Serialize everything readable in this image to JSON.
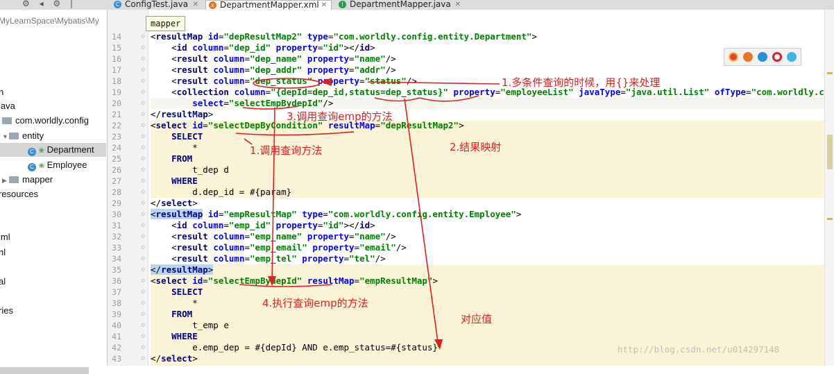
{
  "toolbar": {
    "icons_text": "⚙ ◂ ⚙ |"
  },
  "tabs": [
    {
      "label": "ConfigTest.java",
      "icon": "C",
      "icon_color": "#3a8ecf"
    },
    {
      "label": "DepartmentMapper.xml",
      "icon": "x",
      "icon_color": "#d9762b"
    },
    {
      "label": "DepartmentMapper.java",
      "icon": "I",
      "icon_color": "#2d9a55"
    }
  ],
  "sidebar": {
    "items": [
      {
        "label": "MyLearnSpace\\Mybatis\\My"
      },
      {
        "label": "n"
      },
      {
        "label": "java"
      },
      {
        "label": "com.worldly.config"
      },
      {
        "label": "entity"
      },
      {
        "label": "Department"
      },
      {
        "label": "Employee"
      },
      {
        "label": "mapper"
      },
      {
        "label": "resources"
      },
      {
        "label": "iml"
      },
      {
        "label": "nl"
      },
      {
        "label": "al"
      },
      {
        "label": "ries"
      }
    ]
  },
  "editor": {
    "breadcrumb": "mapper",
    "lines": [
      {
        "num": "14",
        "html": "<span class=\"p\">&lt;</span><span class=\"t\">resultMap</span> <span class=\"a\">id</span>=<span class=\"s\">\"depResultMap2\"</span> <span class=\"a\">type</span>=<span class=\"s\">\"com.worldly.config.entity.Department\"</span>&gt;"
      },
      {
        "num": "15",
        "html": "    &lt;<span class=\"t\">id</span> <span class=\"a\">column</span>=<span class=\"s\">\"dep_id\"</span> <span class=\"a\">property</span>=<span class=\"s\">\"id\"</span>&gt;&lt;/<span class=\"t\">id</span>&gt;"
      },
      {
        "num": "16",
        "html": "    &lt;<span class=\"t\">result</span> <span class=\"a\">column</span>=<span class=\"s\">\"dep_name\"</span> <span class=\"a\">property</span>=<span class=\"s\">\"name\"</span>/&gt;"
      },
      {
        "num": "17",
        "html": "    &lt;<span class=\"t\">result</span> <span class=\"a\">column</span>=<span class=\"s\">\"dep_addr\"</span> <span class=\"a\">property</span>=<span class=\"s\">\"addr\"</span>/&gt;"
      },
      {
        "num": "18",
        "html": "    &lt;<span class=\"t\">result</span> <span class=\"a\">column</span>=<span class=\"s\">\"dep_status\"</span> <span class=\"a\">property</span>=<span class=\"s\">\"status\"</span>/&gt;"
      },
      {
        "num": "19",
        "html": "    &lt;<span class=\"t\">collection</span> <span class=\"a\">column</span>=<span class=\"s\">\"{depId=dep_id,status=dep_status}\"</span> <span class=\"a\">property</span>=<span class=\"s\">\"employeeList\"</span> <span class=\"a\">javaType</span>=<span class=\"s\">\"java.util.List\"</span> <span class=\"a\">ofType</span>=<span class=\"s\">\"com.worldly.config.entity.Employee\"</span>"
      },
      {
        "num": "20",
        "html": "        <span class=\"a\">select</span>=<span class=\"s\">\"selectEmpBydepId\"</span>/&gt;"
      },
      {
        "num": "21",
        "html": "&lt;/<span class=\"t\">resultMap</span>&gt;"
      },
      {
        "num": "22",
        "html": "&lt;<span class=\"t\">select</span> <span class=\"a\">id</span>=<span class=\"s\">\"selectDepByCondition\"</span> <span class=\"a\">resultMap</span>=<span class=\"s\">\"depResultMap2\"</span>&gt;"
      },
      {
        "num": "23",
        "html": "    <span class=\"kw\">SELECT</span>"
      },
      {
        "num": "24",
        "html": "        *"
      },
      {
        "num": "25",
        "html": "    <span class=\"kw\">FROM</span>"
      },
      {
        "num": "26",
        "html": "        t_dep d"
      },
      {
        "num": "27",
        "html": "    <span class=\"kw\">WHERE</span>"
      },
      {
        "num": "28",
        "html": "        d.dep_id = #{param}"
      },
      {
        "num": "29",
        "html": "&lt;/<span class=\"t\">select</span>&gt;"
      },
      {
        "num": "30",
        "html": "<span class=\"tmatch\">&lt;<span class=\"t\">resultMap</span></span> <span class=\"a\">id</span>=<span class=\"s\">\"empResultMap\"</span> <span class=\"a\">type</span>=<span class=\"s\">\"com.worldly.config.entity.Employee\"</span>&gt;"
      },
      {
        "num": "31",
        "html": "    &lt;<span class=\"t\">id</span> <span class=\"a\">column</span>=<span class=\"s\">\"emp_id\"</span> <span class=\"a\">property</span>=<span class=\"s\">\"id\"</span>&gt;&lt;/<span class=\"t\">id</span>&gt;"
      },
      {
        "num": "32",
        "html": "    &lt;<span class=\"t\">result</span> <span class=\"a\">column</span>=<span class=\"s\">\"emp_name\"</span> <span class=\"a\">property</span>=<span class=\"s\">\"name\"</span>/&gt;"
      },
      {
        "num": "33",
        "html": "    &lt;<span class=\"t\">result</span> <span class=\"a\">column</span>=<span class=\"s\">\"emp_email\"</span> <span class=\"a\">property</span>=<span class=\"s\">\"email\"</span>/&gt;"
      },
      {
        "num": "34",
        "html": "    &lt;<span class=\"t\">result</span> <span class=\"a\">column</span>=<span class=\"s\">\"emp_tel\"</span> <span class=\"a\">property</span>=<span class=\"s\">\"tel\"</span>/&gt;"
      },
      {
        "num": "35",
        "html": "<span class=\"tmatch\">&lt;/<span class=\"t\">resultMap</span>&gt;</span>"
      },
      {
        "num": "36",
        "html": "&lt;<span class=\"t\">select</span> <span class=\"a\">id</span>=<span class=\"s\">\"selectEmpBydepId\"</span> <span class=\"a\">resultMap</span>=<span class=\"s\">\"empResultMap\"</span>&gt;"
      },
      {
        "num": "37",
        "html": "    <span class=\"kw\">SELECT</span>"
      },
      {
        "num": "38",
        "html": "        *"
      },
      {
        "num": "39",
        "html": "    <span class=\"kw\">FROM</span>"
      },
      {
        "num": "40",
        "html": "        t_emp e"
      },
      {
        "num": "41",
        "html": "    <span class=\"kw\">WHERE</span>"
      },
      {
        "num": "42",
        "html": "        e.emp_dep = #{depId} AND e.emp_status=#{status}"
      },
      {
        "num": "43",
        "html": "&lt;/<span class=\"t\">select</span>&gt;"
      }
    ]
  },
  "annotations": {
    "a1": "1.多条件查询的时候，用{}来处理",
    "a2": "3.调用查询emp的方法",
    "a3": "1.调用查询方法",
    "a4": "2.结果映射",
    "a5": "4.执行查询emp的方法",
    "a6": "对应值"
  },
  "browsers": [
    {
      "name": "chrome-icon",
      "color": "#e2453c"
    },
    {
      "name": "firefox-icon",
      "color": "#e8752a"
    },
    {
      "name": "safari-icon",
      "color": "#2a8fd8"
    },
    {
      "name": "opera-icon",
      "color": "#d81e2a"
    },
    {
      "name": "ie-icon",
      "color": "#3fb4e0"
    }
  ],
  "watermark": "http://blog.csdn.net/u014297148",
  "colors": {
    "annotation": "#e02020",
    "highlight_band": "#faf3d6"
  }
}
